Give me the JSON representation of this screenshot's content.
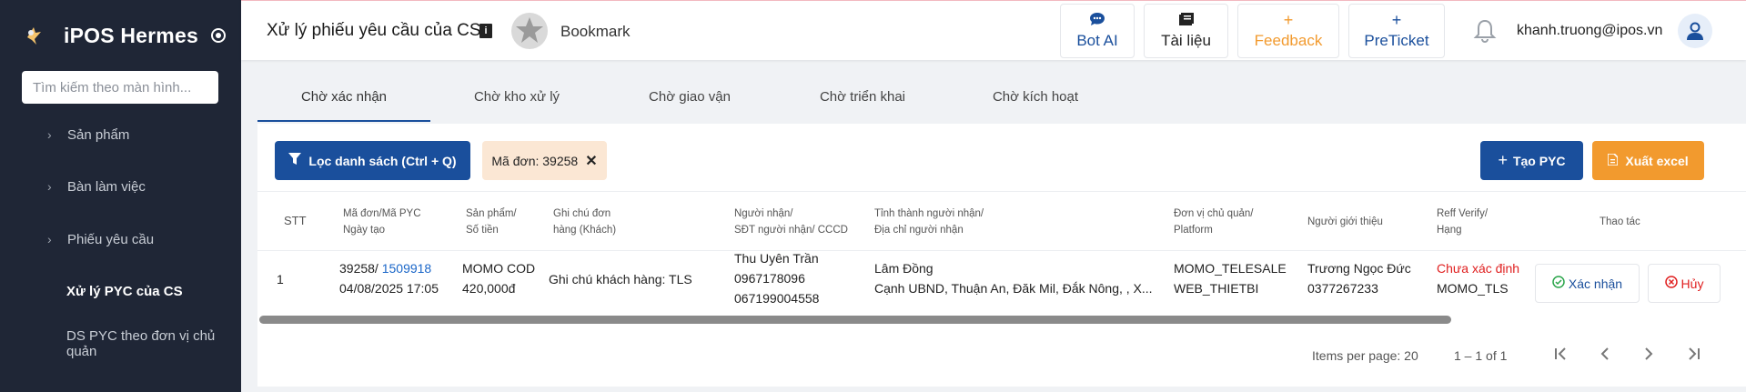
{
  "sidebar": {
    "brand": "iPOS Hermes",
    "search_placeholder": "Tìm kiếm theo màn hình...",
    "items": [
      {
        "label": "Sản phẩm"
      },
      {
        "label": "Bàn làm việc"
      },
      {
        "label": "Phiếu yêu cầu"
      },
      {
        "label": "Xử lý PYC của CS"
      },
      {
        "label": "DS PYC theo đơn vị chủ quản"
      }
    ]
  },
  "header": {
    "title": "Xử lý phiếu yêu cầu của CS",
    "info_icon": "i",
    "bookmark": "Bookmark",
    "buttons": [
      {
        "label": "Bot AI",
        "icon": "chat-icon"
      },
      {
        "label": "Tài liệu",
        "icon": "book-icon"
      },
      {
        "label": "Feedback",
        "icon": "+"
      },
      {
        "label": "PreTicket",
        "icon": "+"
      }
    ],
    "user_email": "khanh.truong@ipos.vn"
  },
  "tabs": [
    {
      "label": "Chờ xác nhận",
      "active": true
    },
    {
      "label": "Chờ kho xử lý"
    },
    {
      "label": "Chờ giao vận"
    },
    {
      "label": "Chờ triển khai"
    },
    {
      "label": "Chờ kích hoạt"
    }
  ],
  "toolbar": {
    "filter_label": "Lọc danh sách (Ctrl + Q)",
    "chip_label": "Mã đơn: 39258",
    "create_label": "Tạo PYC",
    "export_label": "Xuất excel"
  },
  "table": {
    "headers": {
      "stt": "STT",
      "order_1": "Mã đơn/Mã PYC",
      "order_2": "Ngày tạo",
      "product_1": "Sản phẩm/",
      "product_2": "Số tiền",
      "note_1": "Ghi chú đơn",
      "note_2": "hàng (Khách)",
      "receiver_1": "Người nhận/",
      "receiver_2": "SĐT người nhận/ CCCD",
      "province_1": "Tỉnh thành người nhận/",
      "province_2": "Địa chỉ người nhận",
      "unit_1": "Đơn vị chủ quản/",
      "unit_2": "Platform",
      "referrer": "Người giới thiệu",
      "reff_1": "Reff Verify/",
      "reff_2": "Hạng",
      "actions": "Thao tác"
    },
    "rows": [
      {
        "stt": "1",
        "order_code": "39258/ ",
        "pyc_code": "1509918",
        "created": "04/08/2025 17:05",
        "product": "MOMO COD",
        "amount": "420,000đ",
        "note": "Ghi chú khách hàng: TLS",
        "receiver_name": "Thu Uyên Trần",
        "receiver_phone": "0967178096",
        "receiver_id": "067199004558",
        "province": "Lâm Đồng",
        "address": "Cạnh UBND, Thuận An, Đăk Mil, Đắk Nông, , X...",
        "unit": "MOMO_TELESALE",
        "platform": "WEB_THIETBI",
        "referrer_name": "Trương Ngọc Đức",
        "referrer_phone": "0377267233",
        "reff_verify": "Chưa xác định",
        "rank": "MOMO_TLS",
        "confirm_label": "Xác nhận",
        "cancel_label": "Hủy"
      }
    ]
  },
  "pagination": {
    "items_per_page": "Items per page: 20",
    "range": "1 – 1 of 1"
  }
}
